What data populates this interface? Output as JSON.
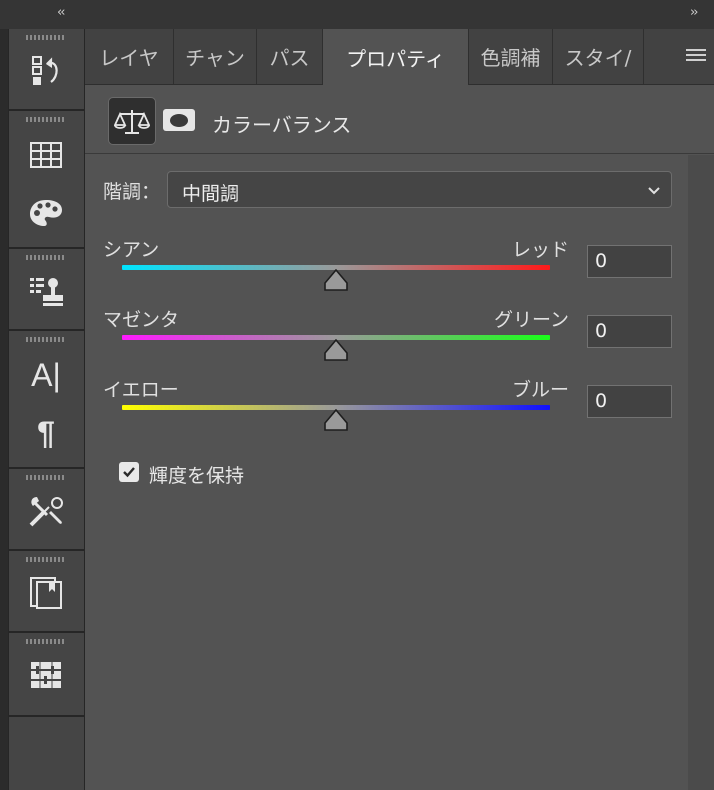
{
  "collapse": {
    "left": "‹‹",
    "right": "››"
  },
  "tabs": [
    {
      "label": "レイヤ",
      "active": false
    },
    {
      "label": "チャン",
      "active": false
    },
    {
      "label": "パス",
      "active": false
    },
    {
      "label": "プロパティ",
      "active": true
    },
    {
      "label": "色調補",
      "active": false
    },
    {
      "label": "スタイ/",
      "active": false
    }
  ],
  "dock_tools": [
    "history-icon",
    "swatches-grid-icon",
    "palette-icon",
    "clone-source-icon",
    "character-icon",
    "paragraph-icon",
    "tool-presets-icon",
    "glyphs-icon",
    "filter-icon"
  ],
  "character_icon_text": "A|",
  "paragraph_icon_text": "¶",
  "header": {
    "title": "カラーバランス"
  },
  "tone": {
    "label": "階調：",
    "value": "中間調"
  },
  "sliders": [
    {
      "left_label": "シアン",
      "right_label": "レッド",
      "value": "0",
      "position": 0.5,
      "from_color": "#00e5ff",
      "to_color": "#ff1a1a"
    },
    {
      "left_label": "マゼンタ",
      "right_label": "グリーン",
      "value": "0",
      "position": 0.5,
      "from_color": "#ff1aff",
      "to_color": "#1aff1a"
    },
    {
      "left_label": "イエロー",
      "right_label": "ブルー",
      "value": "0",
      "position": 0.5,
      "from_color": "#ffff00",
      "to_color": "#1010ff"
    }
  ],
  "preserve_luminosity": {
    "label": "輝度を保持",
    "checked": true
  }
}
